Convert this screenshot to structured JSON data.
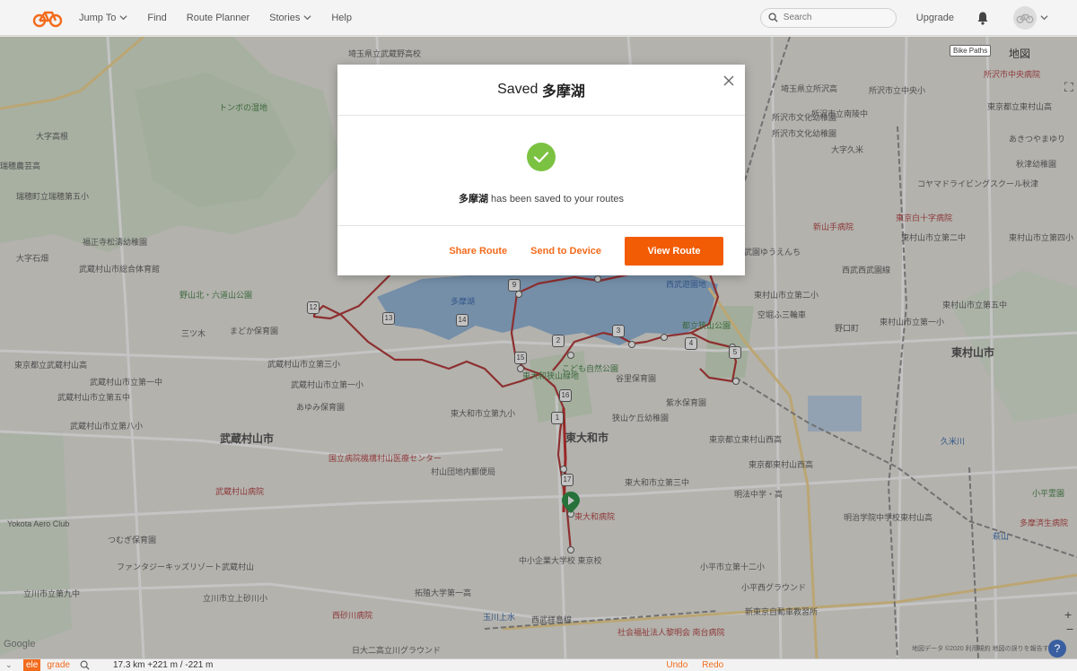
{
  "nav": {
    "items": [
      {
        "label": "Jump To",
        "has_dropdown": true
      },
      {
        "label": "Find",
        "has_dropdown": false
      },
      {
        "label": "Route Planner",
        "has_dropdown": false
      },
      {
        "label": "Stories",
        "has_dropdown": true
      },
      {
        "label": "Help",
        "has_dropdown": false
      }
    ],
    "search_placeholder": "Search",
    "upgrade": "Upgrade"
  },
  "map": {
    "bike_paths": "Bike Paths",
    "map_type": "地図",
    "labels": {
      "l1": "埼玉県立武蔵野高校",
      "l2": "トンボの湿地",
      "l3": "大字高根",
      "l4": "瑞穂農芸高",
      "l5": "瑞穂町立瑞穂第五小",
      "l6": "福正寺松濤幼稚園",
      "l7": "大字石畑",
      "l8": "武蔵村山市総合体育館",
      "l9": "野山北・六道山公園",
      "l10": "三ツ木",
      "l11": "まどか保育園",
      "l12": "東京都立武蔵村山高",
      "l13": "武蔵村山市立第五中",
      "l14": "武蔵村山市立第八小",
      "l15": "武蔵村山市",
      "l16": "Yokota Aero Club",
      "l17": "つむぎ保育園",
      "l18": "ファンタジーキッズリゾート武蔵村山",
      "l19": "立川市立第九中",
      "l20": "立川市立上砂川小",
      "l21": "西砂川病院",
      "l22": "武蔵村山市立第一中",
      "l23": "武蔵村山市立第三小",
      "l24": "武蔵村山市立第一小",
      "l25": "あゆみ保育園",
      "l26": "国立病院機構村山医療センター",
      "l27": "武蔵村山病院",
      "l28": "東大和市",
      "l29": "東大和市立第九小",
      "l30": "東大和病院",
      "l31": "村山団地内郵便局",
      "l32": "中小企業大学校 東京校",
      "l33": "拓殖大学第一高",
      "l34": "東大和狭山緑地",
      "l35": "こども自然公園",
      "l36": "谷里保育園",
      "l37": "狭山ケ丘幼稚園",
      "l38": "紫水保育園",
      "l39": "都立狭山公園",
      "l40": "空堀ふ三輪車",
      "l41": "東大和市立第三中",
      "l42": "明法中学・高",
      "l43": "東京都立東村山西高",
      "l44": "東村山市",
      "l45": "所沢市中央病院",
      "l46": "所沢市文化幼稚園",
      "l47": "コヤマドライビングスクール秋津",
      "l48": "東京白十字病院",
      "l49": "新山手病院",
      "l50": "東村山市立第二中",
      "l51": "東村山市立第五中",
      "l52": "明治学院中学校東村山高",
      "l53": "小平西グラウンド",
      "l54": "新東京自動車教習所",
      "l55": "小平市立第十二小",
      "l56": "社会福祉法人黎明会 南台病院",
      "l57": "西武拝島線",
      "l58": "玉川上水",
      "l59": "日大二高立川グラウンド",
      "l60": "多摩湖",
      "l61": "東京都東村山西高",
      "l62": "久米川",
      "l63": "小平霊園",
      "l64": "萩山",
      "l65": "西武遊園地",
      "l66": "東村山市立第一小",
      "l67": "東村山市立第四小",
      "l68": "多摩済生病院",
      "l69": "大字久米",
      "l70": "秋津幼稚園",
      "l71": "所沢市立南陵中",
      "l72": "埼玉県立所沢高",
      "l73": "所沢市立中央小",
      "l74": "所沢市文化幼稚園",
      "l75": "あきつやまゆり",
      "l76": "東京都立東村山高",
      "l77": "西武園ゆうえんち",
      "l78": "西武西武園線",
      "l79": "東村山市立第二小",
      "l80": "野口町"
    },
    "attribution": "地図データ ©2020  利用規約  地図の誤りを報告する",
    "google": "Google"
  },
  "modal": {
    "title_prefix": "Saved ",
    "title_name": "多摩湖",
    "message_name": "多摩湖",
    "message_suffix": " has been saved to your routes",
    "share": "Share Route",
    "send": "Send to Device",
    "view": "View Route"
  },
  "bottombar": {
    "ele": "ele",
    "grade": "grade",
    "stats": "17.3 km +221 m / -221 m",
    "undo": "Undo",
    "redo": "Redo"
  },
  "colors": {
    "brand_orange": "#f36b1c",
    "primary_button": "#f25c05",
    "success_green": "#7cc242",
    "route_red": "#b02a2a",
    "lake_blue": "#8fb3d9"
  },
  "icons": {
    "logo": "bike-logo-icon",
    "search": "search-icon",
    "bell": "bell-icon",
    "close": "close-icon",
    "check": "check-circle-icon"
  }
}
